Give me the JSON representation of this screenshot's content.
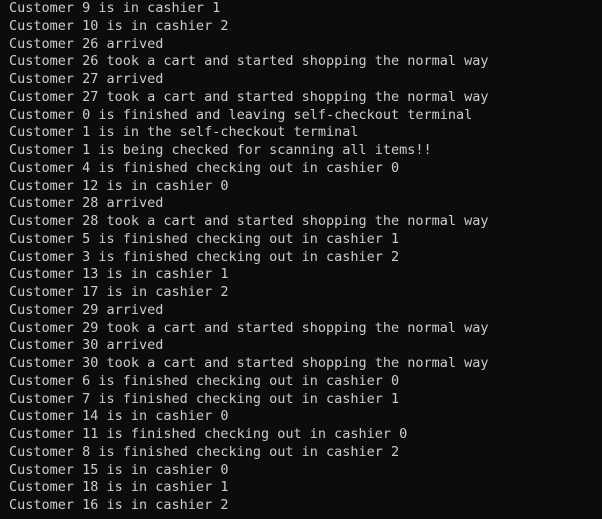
{
  "terminal": {
    "lines": [
      "Customer 9 is in cashier 1",
      "Customer 10 is in cashier 2",
      "Customer 26 arrived",
      "Customer 26 took a cart and started shopping the normal way",
      "Customer 27 arrived",
      "Customer 27 took a cart and started shopping the normal way",
      "Customer 0 is finished and leaving self-checkout terminal",
      "Customer 1 is in the self-checkout terminal",
      "Customer 1 is being checked for scanning all items!!",
      "Customer 4 is finished checking out in cashier 0",
      "Customer 12 is in cashier 0",
      "Customer 28 arrived",
      "Customer 28 took a cart and started shopping the normal way",
      "Customer 5 is finished checking out in cashier 1",
      "Customer 3 is finished checking out in cashier 2",
      "Customer 13 is in cashier 1",
      "Customer 17 is in cashier 2",
      "Customer 29 arrived",
      "Customer 29 took a cart and started shopping the normal way",
      "Customer 30 arrived",
      "Customer 30 took a cart and started shopping the normal way",
      "Customer 6 is finished checking out in cashier 0",
      "Customer 7 is finished checking out in cashier 1",
      "Customer 14 is in cashier 0",
      "Customer 11 is finished checking out in cashier 0",
      "Customer 8 is finished checking out in cashier 2",
      "Customer 15 is in cashier 0",
      "Customer 18 is in cashier 1",
      "Customer 16 is in cashier 2"
    ]
  },
  "colors": {
    "background": "#0c0c0c",
    "text": "#cccccc"
  }
}
